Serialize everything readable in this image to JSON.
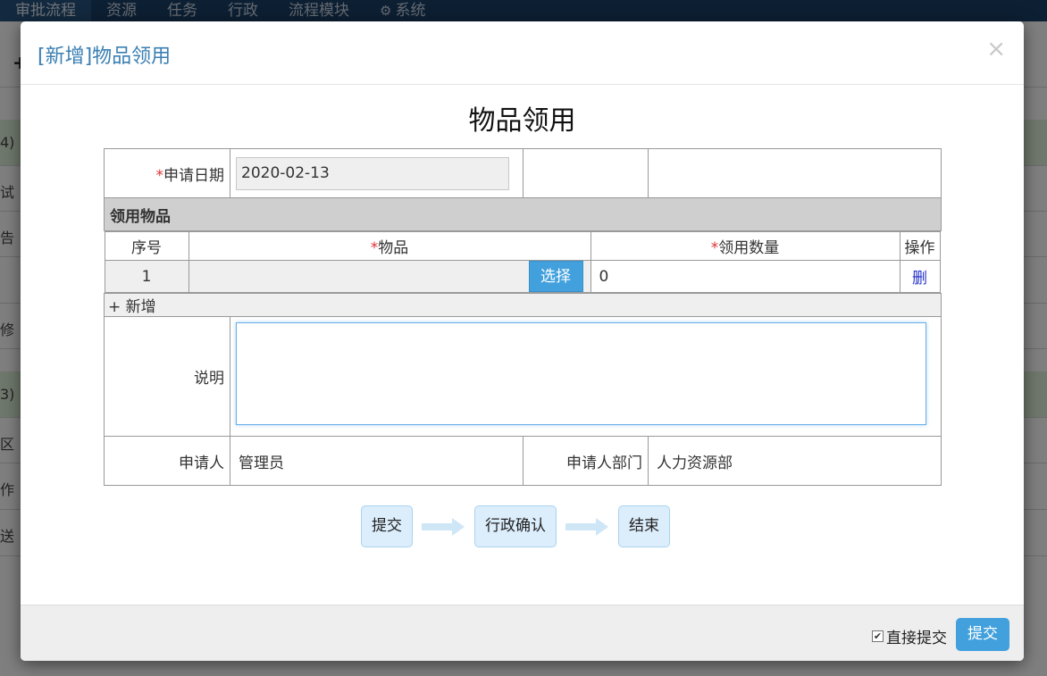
{
  "nav": {
    "items": [
      "审批流程",
      "资源",
      "任务",
      "行政",
      "流程模块"
    ],
    "system": "系统"
  },
  "background": {
    "rows": [
      "4)",
      "试",
      "告",
      "",
      "修",
      "3)",
      "区",
      "作",
      "送"
    ]
  },
  "modal": {
    "title": "[新增]物品领用",
    "close": "×",
    "form_title": "物品领用"
  },
  "form": {
    "required_mark": "*",
    "date_label": "申请日期",
    "date_value": "2020-02-13",
    "section_title": "领用物品",
    "columns": {
      "index": "序号",
      "item": "物品",
      "quantity": "领用数量",
      "action": "操作"
    },
    "rows": [
      {
        "index": "1",
        "item": "",
        "quantity": "0",
        "delete": "删"
      }
    ],
    "select_button": "选择",
    "add_row": "+ 新增",
    "note_label": "说明",
    "note_value": "",
    "applicant_label": "申请人",
    "applicant_value": "管理员",
    "dept_label": "申请人部门",
    "dept_value": "人力资源部"
  },
  "flow": {
    "steps": [
      "提交",
      "行政确认",
      "结束"
    ]
  },
  "footer": {
    "direct_submit_label": "直接提交",
    "direct_submit_checked": true,
    "submit_button": "提交"
  }
}
